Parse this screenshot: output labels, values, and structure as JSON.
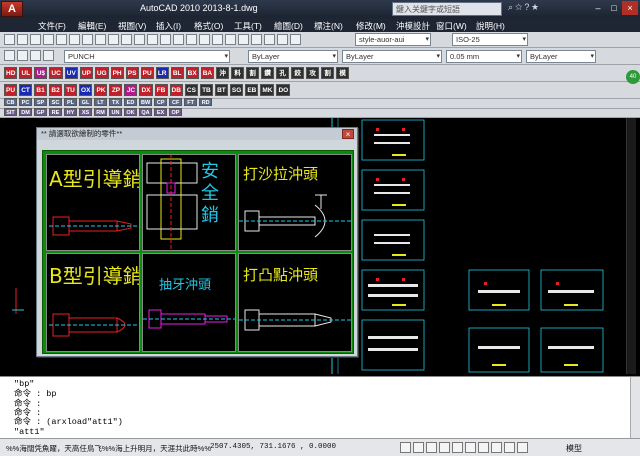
{
  "window": {
    "app_button": "A",
    "title": "AutoCAD 2010    2013-8-1.dwg",
    "search_placeholder": "鍵入关鍵字或短語",
    "minimize": "–",
    "maximize": "□",
    "close": "×"
  },
  "menu": {
    "items": [
      "文件(F)",
      "編輯(E)",
      "視圖(V)",
      "插入(I)",
      "格式(O)",
      "工具(T)",
      "繪圖(D)",
      "標注(N)",
      "修改(M)",
      "沖模設計",
      "窗口(W)",
      "說明(H)"
    ]
  },
  "toolbar": {
    "text_style": "style-auor-aui",
    "dim_style": "ISO-25",
    "layer": "PUNCH",
    "color": "ByLayer",
    "linetype": "ByLayer",
    "lineweight": "0.05 mm",
    "plot_style": "ByLayer"
  },
  "custom_toolbar": {
    "row1": [
      "HD",
      "UL",
      "U$",
      "UC",
      "UV",
      "UP",
      "UG",
      "PH",
      "PS",
      "PU",
      "LR",
      "BL",
      "BX",
      "BA",
      "沖",
      "料",
      "割",
      "鑽",
      "孔",
      "鉸",
      "攻",
      "割",
      "模"
    ],
    "row1_colors": [
      "#c0202a",
      "#c0202a",
      "#b01a8a",
      "#c0202a",
      "#1a2ab0",
      "#c0202a",
      "#c0202a",
      "#c0202a",
      "#c0202a",
      "#c0202a",
      "#1a2ab0",
      "#c0202a",
      "#c0202a",
      "#c0202a",
      "#303030",
      "#303030",
      "#303030",
      "#303030",
      "#303030",
      "#303030",
      "#303030",
      "#303030",
      "#303030"
    ],
    "row2": [
      "PU",
      "CT",
      "B1",
      "B2",
      "TU",
      "OX",
      "PK",
      "ZP",
      "JC",
      "DX",
      "FB",
      "DB",
      "CS",
      "TB",
      "BT",
      "SG",
      "EB",
      "MK",
      "DO"
    ],
    "row2_colors": [
      "#c0202a",
      "#1a2ab0",
      "#c0202a",
      "#c0202a",
      "#c0202a",
      "#1a2ab0",
      "#c0202a",
      "#c0202a",
      "#b01a8a",
      "#c0202a",
      "#c0202a",
      "#c0202a",
      "#303030",
      "#303030",
      "#303030",
      "#303030",
      "#303030",
      "#303030",
      "#303030"
    ],
    "row3": [
      "CB",
      "PC",
      "SP",
      "SC",
      "PL",
      "GL",
      "LT",
      "TX",
      "ED",
      "BW",
      "CP",
      "CF",
      "FT",
      "RD"
    ],
    "row4": [
      "SIT",
      "DM",
      "GP",
      "RE",
      "HY",
      "XS",
      "RM",
      "UN",
      "OK",
      "QA",
      "EX",
      "OP"
    ]
  },
  "dialog": {
    "title": "** 請選取欲繪制的零件**",
    "close": "×",
    "cells": [
      {
        "label": "A型引導銷",
        "color": "#e8e81a"
      },
      {
        "label": "安全銷",
        "color": "#20c8e8"
      },
      {
        "label": "打沙拉沖頭",
        "color": "#e8e81a"
      },
      {
        "label": "B型引導銷",
        "color": "#e8e81a"
      },
      {
        "label": "抽牙沖頭",
        "color": "#20c8e8"
      },
      {
        "label": "打凸點沖頭",
        "color": "#e8e81a"
      }
    ]
  },
  "command": {
    "lines": [
      "\"bp\"",
      "命令 : bp",
      "命令 :",
      "命令 :",
      "命令 : (arxload\"att1\")",
      "\"att1\""
    ]
  },
  "status": {
    "message": "%%海闊凭魚躍，天高任鳥飞%%海上升明月，天涯共此時%%",
    "coordinates": "2507.4305, 731.1676 , 0.0000",
    "model": "模型"
  },
  "colors": {
    "dialog_body": "#0c8a0c",
    "canvas": "#000000",
    "line_cyan": "#20c8e8",
    "line_yellow": "#e8e81a",
    "line_red": "#e82020",
    "line_magenta": "#e820e8"
  }
}
